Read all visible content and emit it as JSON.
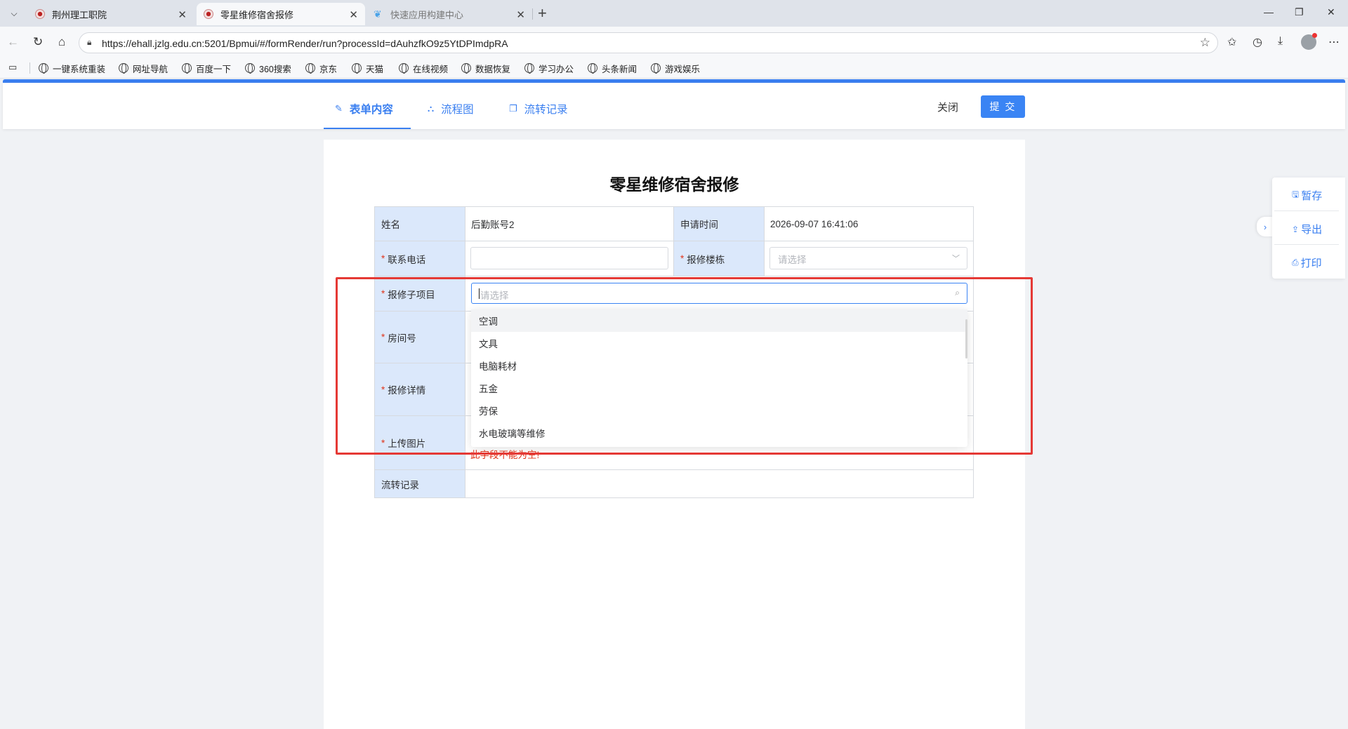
{
  "browser": {
    "tabs": [
      {
        "title": "荆州理工职院"
      },
      {
        "title": "零星维修宿舍报修"
      },
      {
        "title": "快速应用构建中心"
      }
    ],
    "url": "https://ehall.jzlg.edu.cn:5201/Bpmui/#/formRender/run?processId=dAuhzfkO9z5YtDPImdpRA",
    "bookmarks": [
      "一键系统重装",
      "网址导航",
      "百度一下",
      "360搜索",
      "京东",
      "天猫",
      "在线视频",
      "数据恢复",
      "学习办公",
      "头条新闻",
      "游戏娱乐"
    ]
  },
  "header": {
    "tabs": [
      {
        "label": "表单内容",
        "icon": "edit-icon"
      },
      {
        "label": "流程图",
        "icon": "flowchart-icon"
      },
      {
        "label": "流转记录",
        "icon": "copy-icon"
      }
    ],
    "close_label": "关闭",
    "submit_label": "提 交"
  },
  "form": {
    "title": "零星维修宿舍报修",
    "name_label": "姓名",
    "name_value": "后勤账号2",
    "apply_time_label": "申请时间",
    "apply_time_value": "2026-09-07 16:41:06",
    "phone_label": "联系电话",
    "building_label": "报修楼栋",
    "building_placeholder": "请选择",
    "subitem_label": "报修子项目",
    "subitem_placeholder": "请选择",
    "room_label": "房间号",
    "detail_label": "报修详情",
    "image_label": "上传图片",
    "image_error": "此字段不能为空!",
    "record_label": "流转记录",
    "required_mark": "*"
  },
  "dropdown": {
    "options": [
      "空调",
      "文具",
      "电脑耗材",
      "五金",
      "劳保",
      "水电玻璃等维修"
    ]
  },
  "side_panel": {
    "save_label": "暂存",
    "export_label": "导出",
    "print_label": "打印"
  }
}
